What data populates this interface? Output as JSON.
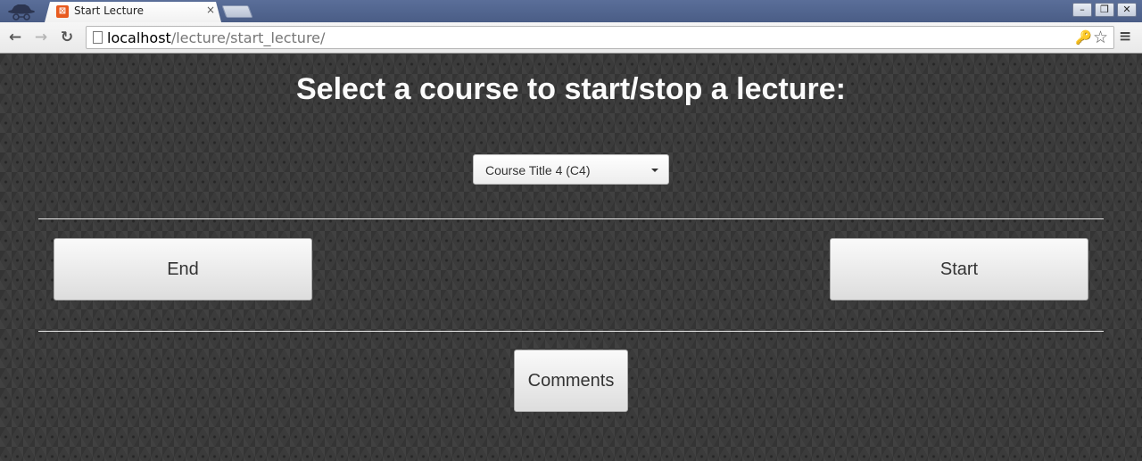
{
  "browser": {
    "tab": {
      "title": "Start Lecture",
      "close_glyph": "×",
      "favicon": "favicon-icon"
    },
    "window_controls": {
      "minimize": "–",
      "restore": "❐",
      "close": "✕"
    },
    "nav": {
      "back": "←",
      "forward": "→",
      "reload": "↻"
    },
    "address": {
      "host": "localhost",
      "path": "/lecture/start_lecture/"
    },
    "icons": {
      "key": "🔑",
      "star": "☆",
      "menu": "≡"
    }
  },
  "page": {
    "heading": "Select a course to start/stop a lecture:",
    "course_select": {
      "selected": "Course Title 4 (C4)"
    },
    "buttons": {
      "end": "End",
      "start": "Start",
      "comments": "Comments"
    }
  }
}
